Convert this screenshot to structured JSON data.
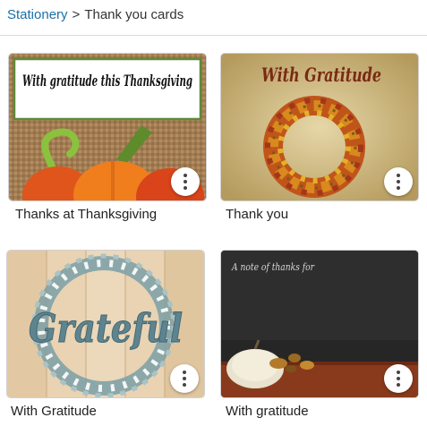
{
  "breadcrumb": {
    "parent": "Stationery",
    "separator": ">",
    "current": "Thank you cards"
  },
  "cards": [
    {
      "caption": "Thanks at Thanksgiving",
      "image_text": "With gratitude this Thanksgiving",
      "more_icon": "more-vert-icon"
    },
    {
      "caption": "Thank you",
      "image_text": "With Gratitude",
      "more_icon": "more-vert-icon"
    },
    {
      "caption": "With Gratitude",
      "image_text": "Grateful",
      "more_icon": "more-vert-icon"
    },
    {
      "caption": "With gratitude",
      "image_text": "A note of thanks for",
      "more_icon": "more-vert-icon"
    }
  ],
  "colors": {
    "link": "#1a6fa8",
    "divider": "#dcdcdc"
  }
}
